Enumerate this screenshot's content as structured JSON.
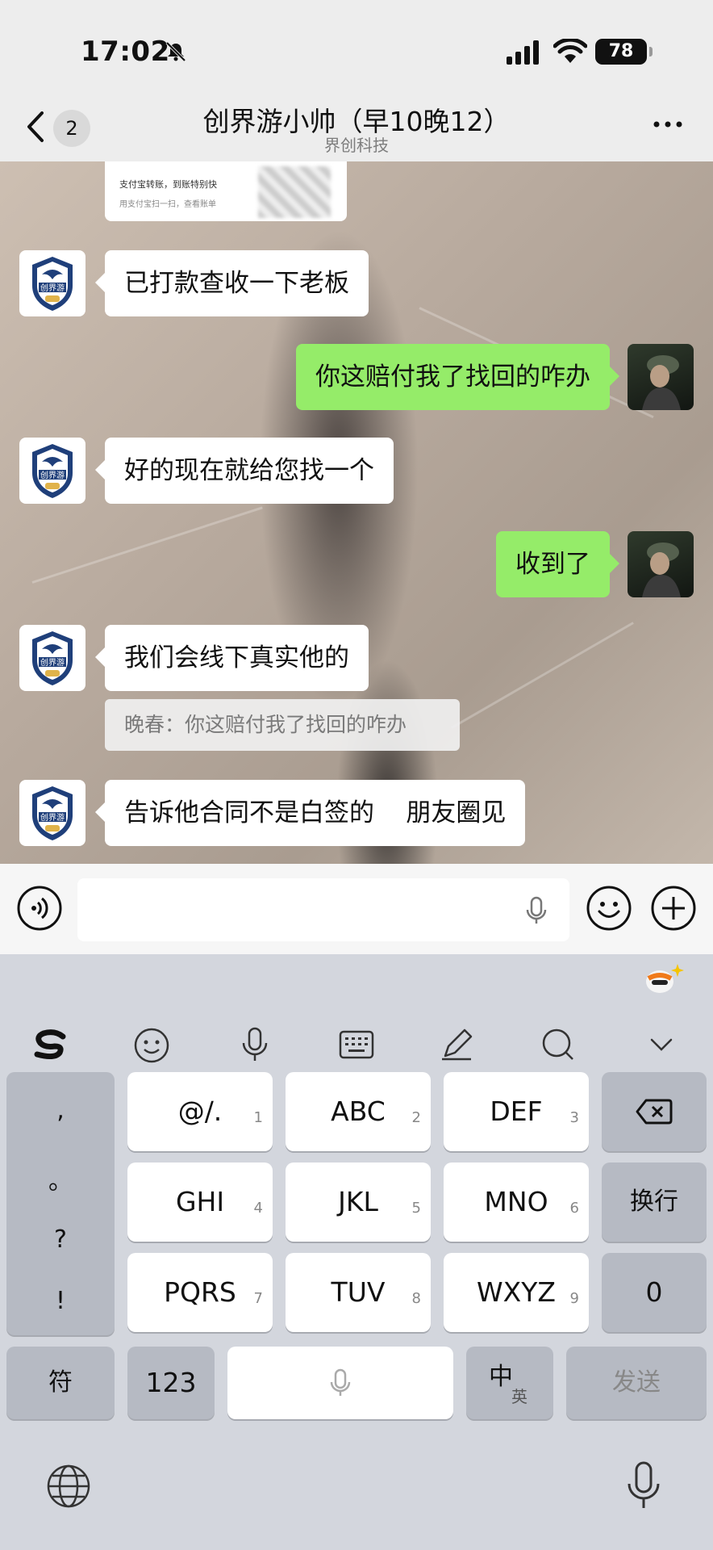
{
  "status": {
    "time": "17:02",
    "battery": "78"
  },
  "nav": {
    "back_count": "2",
    "title": "创界游小帅（早10晚12）",
    "subtitle": "界创科技"
  },
  "image_card": {
    "line1": "支付宝转账，到账特别快",
    "line2": "用支付宝扫一扫，查看账单"
  },
  "messages": [
    {
      "side": "left",
      "text": "已打款查收一下老板"
    },
    {
      "side": "right",
      "text": "你这赔付我了找回的咋办"
    },
    {
      "side": "left",
      "text": "好的现在就给您找一个"
    },
    {
      "side": "right",
      "text": "收到了"
    },
    {
      "side": "left",
      "text": "我们会线下真实他的"
    },
    {
      "side": "left",
      "text": "告诉他合同不是白签的    朋友圈见"
    }
  ],
  "quote": {
    "text": "晚春：你这赔付我了找回的咋办"
  },
  "keyboard": {
    "punct": [
      ",",
      "。",
      "?",
      "!"
    ],
    "row1": [
      {
        "label": "@/.",
        "num": "1"
      },
      {
        "label": "ABC",
        "num": "2"
      },
      {
        "label": "DEF",
        "num": "3"
      }
    ],
    "row2": [
      {
        "label": "GHI",
        "num": "4"
      },
      {
        "label": "JKL",
        "num": "5"
      },
      {
        "label": "MNO",
        "num": "6"
      }
    ],
    "row3": [
      {
        "label": "PQRS",
        "num": "7"
      },
      {
        "label": "TUV",
        "num": "8"
      },
      {
        "label": "WXYZ",
        "num": "9"
      }
    ],
    "enter": "换行",
    "zero": "0",
    "symbols": "符",
    "num123": "123",
    "lang_main": "中",
    "lang_sub": "英",
    "send": "发送"
  },
  "colors": {
    "bubble_self": "#95ec69",
    "bubble_other": "#ffffff",
    "keyboard_bg": "#d3d6dd"
  }
}
